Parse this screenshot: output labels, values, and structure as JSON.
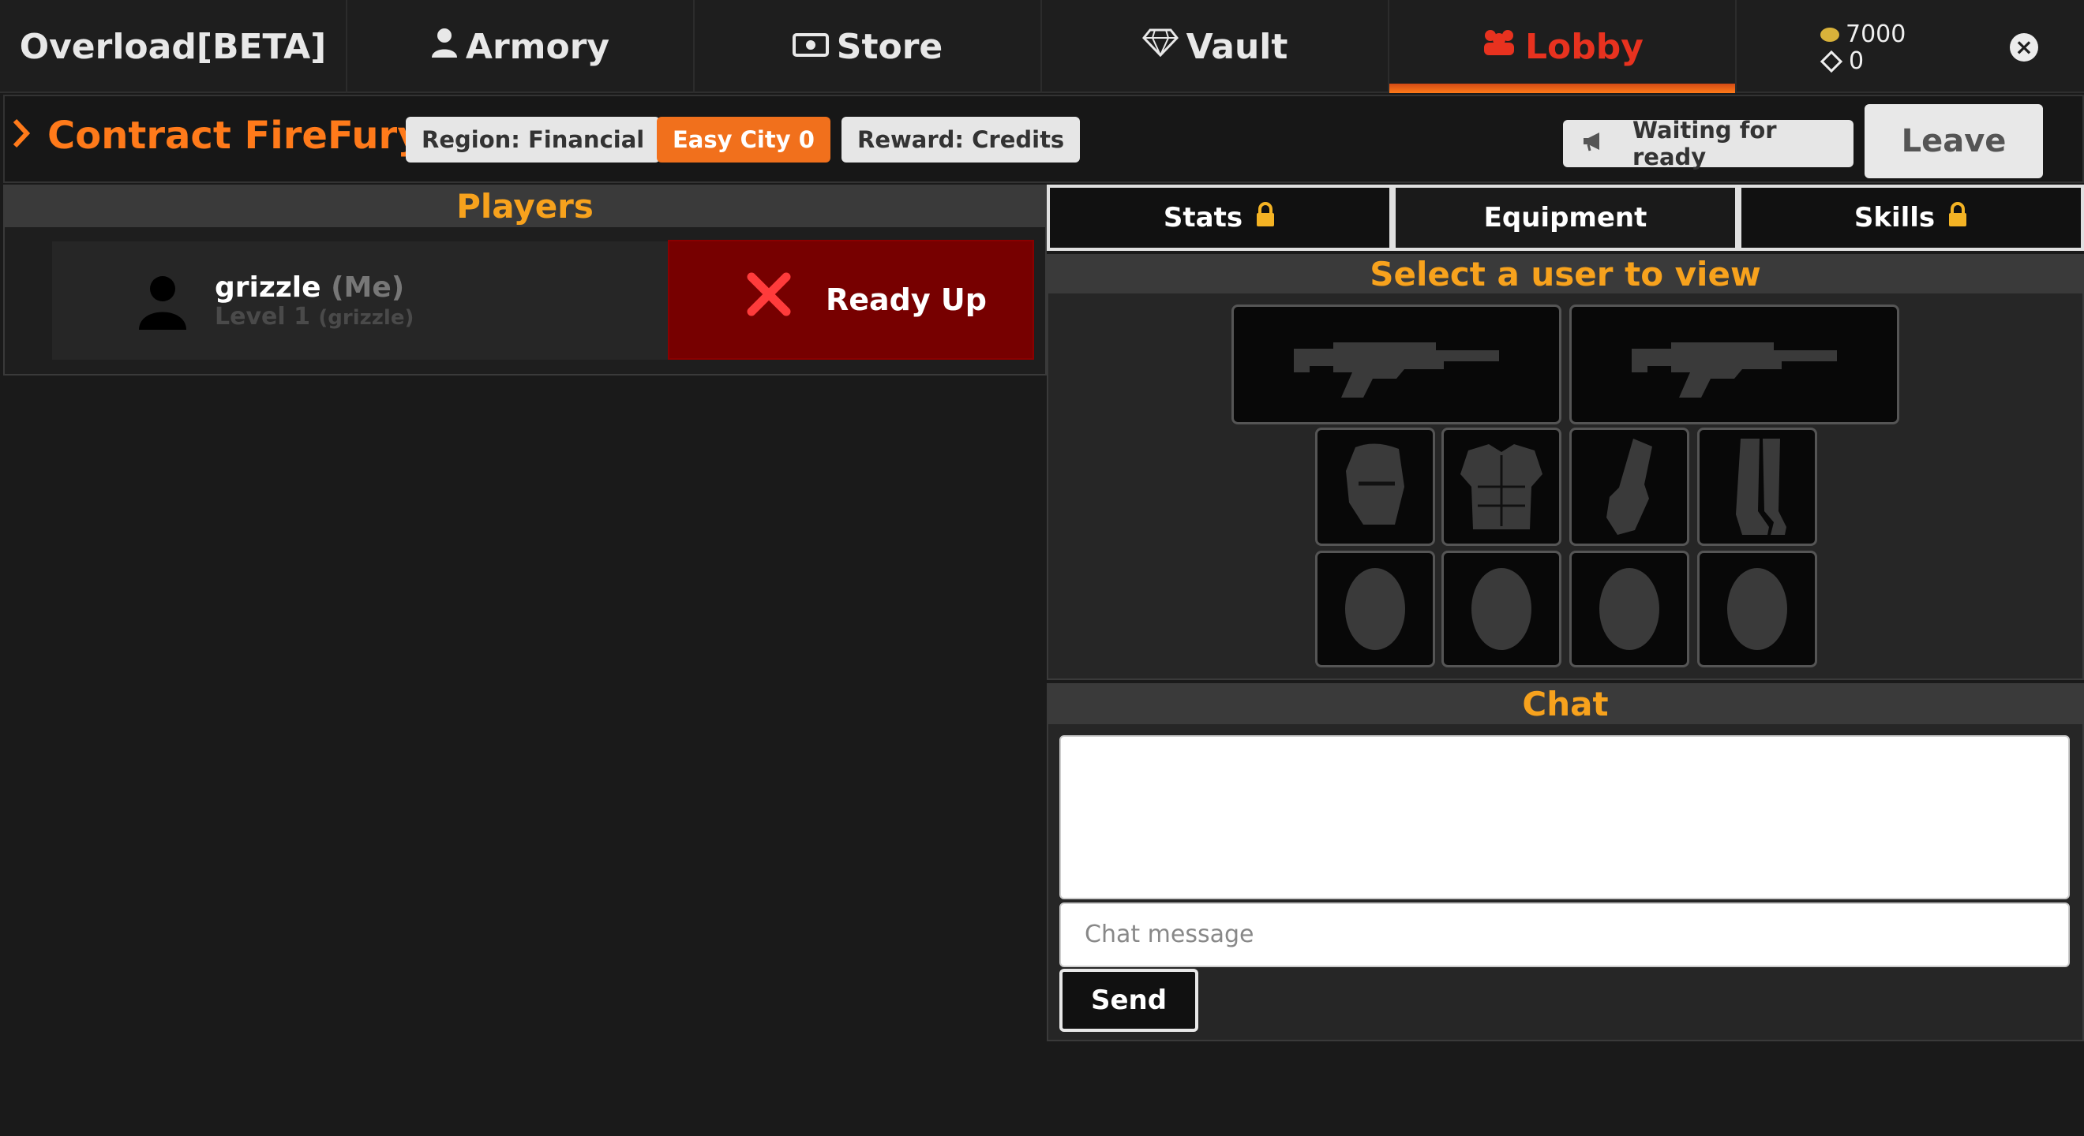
{
  "nav": {
    "tabs": [
      {
        "label": "Overload[BETA]",
        "icon": ""
      },
      {
        "label": "Armory",
        "icon": "user-icon"
      },
      {
        "label": "Store",
        "icon": "cash-icon"
      },
      {
        "label": "Vault",
        "icon": "diamond-icon"
      },
      {
        "label": "Lobby",
        "icon": "users-icon",
        "active": true
      }
    ],
    "wallet": {
      "credits": "7000",
      "gems": "0"
    }
  },
  "contract": {
    "title": "Contract FireFury",
    "region": "Region: Financial",
    "difficulty": "Easy City 0",
    "reward": "Reward: Credits",
    "status": "Waiting for ready",
    "leave_label": "Leave"
  },
  "players": {
    "header": "Players",
    "list": [
      {
        "name": "grizzle",
        "tag": "(Me)",
        "level": "Level 1",
        "account": "(grizzle)"
      }
    ],
    "ready_label": "Ready Up"
  },
  "right_tabs": [
    {
      "label": "Stats",
      "locked": true
    },
    {
      "label": "Equipment",
      "locked": false,
      "active": true
    },
    {
      "label": "Skills",
      "locked": true
    }
  ],
  "equipment": {
    "header": "Select a user to view",
    "slots": [
      "primary-weapon",
      "secondary-weapon",
      "helmet",
      "chest-armor",
      "gloves",
      "boots",
      "mod-1",
      "mod-2",
      "mod-3",
      "mod-4"
    ]
  },
  "chat": {
    "header": "Chat",
    "placeholder": "Chat message",
    "send_label": "Send"
  },
  "colors": {
    "accent": "#f7a21d",
    "lobby_active": "#e8321f",
    "contract_title": "#ff7a1a",
    "ready_bg": "#770000"
  }
}
